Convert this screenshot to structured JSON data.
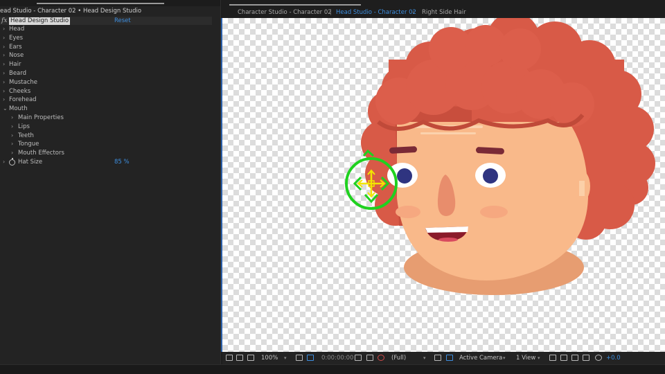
{
  "effect_controls": {
    "title": "ead Studio - Character 02 • Head Design Studio",
    "effect_name": "Head Design Studio",
    "reset_label": "Reset",
    "fx_glyph": "fx",
    "properties": [
      {
        "label": "Head",
        "level": 0,
        "expanded": false
      },
      {
        "label": "Eyes",
        "level": 0,
        "expanded": false
      },
      {
        "label": "Ears",
        "level": 0,
        "expanded": false
      },
      {
        "label": "Nose",
        "level": 0,
        "expanded": false
      },
      {
        "label": "Hair",
        "level": 0,
        "expanded": false
      },
      {
        "label": "Beard",
        "level": 0,
        "expanded": false
      },
      {
        "label": "Mustache",
        "level": 0,
        "expanded": false
      },
      {
        "label": "Cheeks",
        "level": 0,
        "expanded": false
      },
      {
        "label": "Forehead",
        "level": 0,
        "expanded": false
      },
      {
        "label": "Mouth",
        "level": 0,
        "expanded": true
      },
      {
        "label": "Main Properties",
        "level": 1,
        "expanded": false
      },
      {
        "label": "Lips",
        "level": 1,
        "expanded": false
      },
      {
        "label": "Teeth",
        "level": 1,
        "expanded": false
      },
      {
        "label": "Tongue",
        "level": 1,
        "expanded": false
      },
      {
        "label": "Mouth Effectors",
        "level": 1,
        "expanded": false
      }
    ],
    "hat_size": {
      "label": "Hat Size",
      "value": "85",
      "unit": "%"
    }
  },
  "composition_tabs": [
    {
      "label": "Character Studio - Character 02",
      "active": false
    },
    {
      "label": "Head Studio - Character 02",
      "active": true
    },
    {
      "label": "Right Side Hair",
      "active": false
    }
  ],
  "viewer_toolbar": {
    "zoom": "100%",
    "timecode": "0:00:00:00",
    "resolution": "(Full)",
    "camera": "Active Camera",
    "views": "1 View",
    "exposure": "+0.0"
  },
  "colors": {
    "accent_blue": "#3e8fe0",
    "hair": "#d85a47",
    "skin": "#f9b98a",
    "gizmo_green": "#1fd11f",
    "gizmo_yellow": "#f2e600"
  }
}
